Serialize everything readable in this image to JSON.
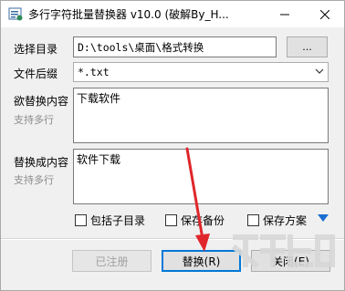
{
  "window": {
    "title": "多行字符批量替换器 v10.0 (破解By_H...",
    "minimize_icon": "minimize-icon",
    "close_icon": "close-icon"
  },
  "form": {
    "dir_label": "选择目录",
    "dir_value": "D:\\tools\\桌面\\格式转换",
    "browse_label": "...",
    "ext_label": "文件后缀",
    "ext_value": "*.txt",
    "find_label": "欲替换内容",
    "find_sublabel": "支持多行",
    "find_value": "下载软件",
    "replace_label": "替换成内容",
    "replace_sublabel": "支持多行",
    "replace_value": "软件下载"
  },
  "options": {
    "include_subdirs": "包括子目录",
    "save_backup": "保存备份",
    "save_scheme": "保存方案"
  },
  "buttons": {
    "registered": "已注册",
    "replace": "替换(R)",
    "close": "关闭(E)"
  },
  "colors": {
    "accent": "#0078d7",
    "annotation_arrow": "#e0262b",
    "expand_triangle": "#1a6fd1"
  }
}
